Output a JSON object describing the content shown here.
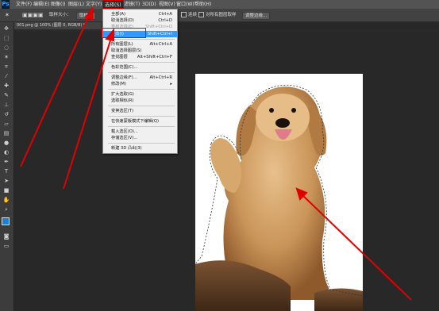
{
  "app": {
    "logo": "Ps"
  },
  "menubar": {
    "items": [
      "文件(F)",
      "编辑(E)",
      "图像(I)",
      "图层(L)",
      "文字(Y)",
      "选择(S)",
      "滤镜(T)",
      "3D(D)",
      "视图(V)",
      "窗口(W)",
      "帮助(H)"
    ]
  },
  "optionsbar": {
    "sample_size_label": "取样大小：",
    "sample_size_value": "取样点",
    "contiguous_label": "连续",
    "all_layers_label": "对所有图层取样",
    "refine_edge_button": "调整边缘..."
  },
  "document": {
    "tab": "001.png @ 100% (图层 0, RGB/8) *"
  },
  "select_menu": {
    "items": [
      {
        "label": "全部(A)",
        "shortcut": "Ctrl+A",
        "disabled": false,
        "highlight": false
      },
      {
        "label": "取消选择(D)",
        "shortcut": "Ctrl+D",
        "disabled": false,
        "highlight": false
      },
      {
        "label": "重新选择(E)",
        "shortcut": "Shift+Ctrl+D",
        "disabled": true,
        "highlight": false
      },
      {
        "label": "反向(I)",
        "shortcut": "Shift+Ctrl+I",
        "disabled": false,
        "highlight": true
      },
      {
        "label": "所有图层(L)",
        "shortcut": "Alt+Ctrl+A",
        "disabled": false,
        "highlight": false
      },
      {
        "label": "取消选择图层(S)",
        "shortcut": "",
        "disabled": false,
        "highlight": false
      },
      {
        "label": "查找图层",
        "shortcut": "Alt+Shift+Ctrl+F",
        "disabled": false,
        "highlight": false
      },
      {
        "label": "色彩范围(C)...",
        "shortcut": "",
        "disabled": false,
        "highlight": false
      },
      {
        "label": "调整边缘(F)...",
        "shortcut": "Alt+Ctrl+R",
        "disabled": false,
        "highlight": false
      },
      {
        "label": "修改(M)",
        "shortcut": "",
        "disabled": false,
        "highlight": false,
        "submenu": true
      },
      {
        "label": "扩大选取(G)",
        "shortcut": "",
        "disabled": false,
        "highlight": false
      },
      {
        "label": "选取相似(R)",
        "shortcut": "",
        "disabled": false,
        "highlight": false
      },
      {
        "label": "变换选区(T)",
        "shortcut": "",
        "disabled": false,
        "highlight": false
      },
      {
        "label": "在快速蒙版模式下编辑(Q)",
        "shortcut": "",
        "disabled": false,
        "highlight": false
      },
      {
        "label": "载入选区(O)...",
        "shortcut": "",
        "disabled": false,
        "highlight": false
      },
      {
        "label": "存储选区(V)...",
        "shortcut": "",
        "disabled": false,
        "highlight": false
      },
      {
        "label": "新建 3D 凸出(3)",
        "shortcut": "",
        "disabled": false,
        "highlight": false
      }
    ],
    "submenu_arrow": "▸"
  },
  "colors": {
    "highlight": "#3399ff",
    "annotation": "#e00000",
    "panel": "#535353"
  }
}
